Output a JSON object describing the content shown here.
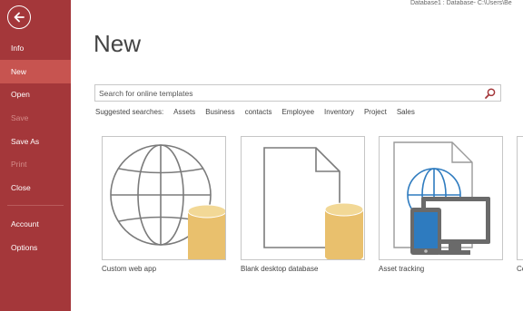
{
  "window": {
    "title_path": "Database1 : Database- C:\\Users\\Be"
  },
  "sidebar": {
    "items": [
      {
        "label": "Info",
        "active": false,
        "disabled": false
      },
      {
        "label": "New",
        "active": true,
        "disabled": false
      },
      {
        "label": "Open",
        "active": false,
        "disabled": false
      },
      {
        "label": "Save",
        "active": false,
        "disabled": true
      },
      {
        "label": "Save As",
        "active": false,
        "disabled": false
      },
      {
        "label": "Print",
        "active": false,
        "disabled": true
      },
      {
        "label": "Close",
        "active": false,
        "disabled": false
      },
      {
        "label": "Account",
        "active": false,
        "disabled": false
      },
      {
        "label": "Options",
        "active": false,
        "disabled": false
      }
    ]
  },
  "main": {
    "title": "New",
    "search": {
      "placeholder": "Search for online templates"
    },
    "suggested": {
      "label": "Suggested searches:",
      "links": [
        "Assets",
        "Business",
        "contacts",
        "Employee",
        "Inventory",
        "Project",
        "Sales"
      ]
    },
    "templates": [
      {
        "label": "Custom web app",
        "icon": "globe-database-icon"
      },
      {
        "label": "Blank desktop database",
        "icon": "document-database-icon"
      },
      {
        "label": "Asset tracking",
        "icon": "asset-devices-icon"
      },
      {
        "label": "Co",
        "icon": "partial-template-icon"
      }
    ]
  },
  "colors": {
    "sidebar_bg": "#a4373a",
    "sidebar_active": "#c75450",
    "database_gold": "#e9c06d"
  }
}
